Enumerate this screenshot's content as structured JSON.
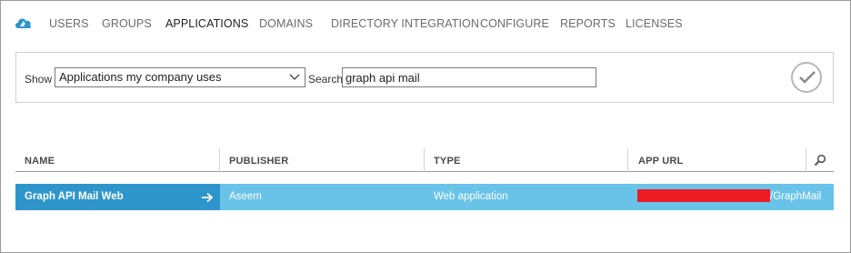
{
  "nav": {
    "logo_icon": "azure-cloud-icon",
    "tabs": [
      {
        "label": "USERS",
        "active": false
      },
      {
        "label": "GROUPS",
        "active": false
      },
      {
        "label": "APPLICATIONS",
        "active": true
      },
      {
        "label": "DOMAINS",
        "active": false
      },
      {
        "label": "DIRECTORY INTEGRATION",
        "active": false
      },
      {
        "label": "CONFIGURE",
        "active": false
      },
      {
        "label": "REPORTS",
        "active": false
      },
      {
        "label": "LICENSES",
        "active": false
      }
    ]
  },
  "filter": {
    "show_label": "Show",
    "show_value": "Applications my company uses",
    "search_label": "Search",
    "search_value": "graph api mail",
    "confirm_icon": "checkmark-icon"
  },
  "table": {
    "columns": [
      "NAME",
      "PUBLISHER",
      "TYPE",
      "APP URL"
    ],
    "search_icon": "magnifier-icon",
    "rows": [
      {
        "name": "Graph API Mail Web",
        "publisher": "Aseem",
        "type": "Web application",
        "app_url_suffix": "/GraphMail",
        "url_redacted": true
      }
    ]
  },
  "colors": {
    "row_selected": "#69c3e8",
    "name_cell_selected": "#2e95cb",
    "redaction": "#ed1c24",
    "logo": "#2e95cb"
  }
}
